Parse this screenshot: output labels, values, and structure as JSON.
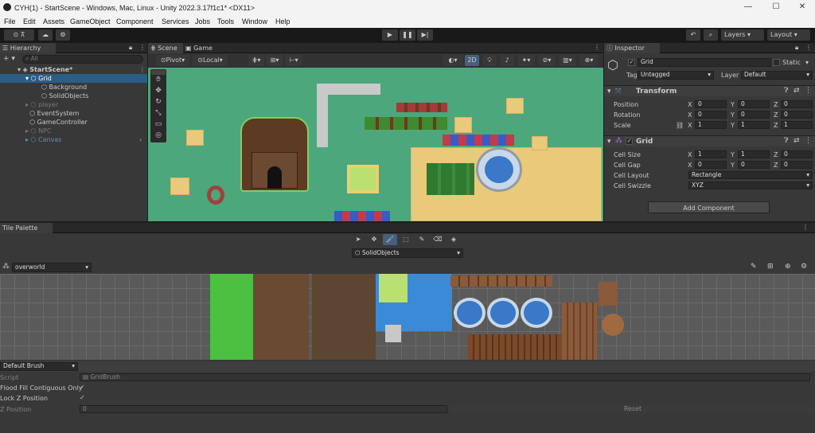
{
  "window": {
    "title": "CYH(1) - StartScene - Windows, Mac, Linux - Unity 2022.3.17f1c1* <DX11>",
    "minimize": "—",
    "maximize": "☐",
    "close": "✕"
  },
  "menu": [
    "File",
    "Edit",
    "Assets",
    "GameObject",
    "Component",
    "Services",
    "Jobs",
    "Tools",
    "Window",
    "Help"
  ],
  "toolbar": {
    "account": "⊙ ⊼",
    "cloud": "☁",
    "settings": "⚙",
    "play": "▶",
    "pause": "❚❚",
    "step": "▶|",
    "history": "↶",
    "search": "⌕",
    "layers": "Layers",
    "layout": "Layout"
  },
  "hierarchy": {
    "tab": "Hierarchy",
    "search_placeholder": "All",
    "add": "+ ▾",
    "items": [
      {
        "label": "StartScene*"
      },
      {
        "label": "Grid"
      },
      {
        "label": "Background"
      },
      {
        "label": "SolidObjects"
      },
      {
        "label": "player"
      },
      {
        "label": "EventSystem"
      },
      {
        "label": "GameController"
      },
      {
        "label": "NPC"
      },
      {
        "label": "Canvas"
      }
    ]
  },
  "scene": {
    "tabs": [
      "Scene",
      "Game"
    ],
    "pivot": "Pivot",
    "local": "Local",
    "mode2d": "2D"
  },
  "inspector": {
    "tab": "Inspector",
    "name": "Grid",
    "static": "Static",
    "tag_label": "Tag",
    "tag_value": "Untagged",
    "layer_label": "Layer",
    "layer_value": "Default",
    "transform": {
      "title": "Transform",
      "rows": [
        {
          "label": "Position",
          "x": "0",
          "y": "0",
          "z": "0"
        },
        {
          "label": "Rotation",
          "x": "0",
          "y": "0",
          "z": "0"
        },
        {
          "label": "Scale",
          "x": "1",
          "y": "1",
          "z": "1"
        }
      ]
    },
    "grid": {
      "title": "Grid",
      "cell_size": {
        "label": "Cell Size",
        "x": "1",
        "y": "1",
        "z": "0"
      },
      "cell_gap": {
        "label": "Cell Gap",
        "x": "0",
        "y": "0",
        "z": "0"
      },
      "cell_layout": {
        "label": "Cell Layout",
        "value": "Rectangle"
      },
      "cell_swizzle": {
        "label": "Cell Swizzle",
        "value": "XYZ"
      }
    },
    "add_component": "Add Component"
  },
  "palette": {
    "tab": "Tile Palette",
    "target": "SolidObjects",
    "palette_name": "overworld",
    "brush": "Default Brush",
    "script_label": "Script",
    "script_value": "GridBrush",
    "flood_label": "Flood Fill Contiguous Only",
    "lockz_label": "Lock Z Position",
    "zpos_label": "Z Position",
    "zpos_value": "0",
    "reset": "Reset"
  },
  "colors": {
    "editor_bg": "#383838",
    "scene_grass": "#4ca77c",
    "accent_blue": "#3a72b0"
  }
}
